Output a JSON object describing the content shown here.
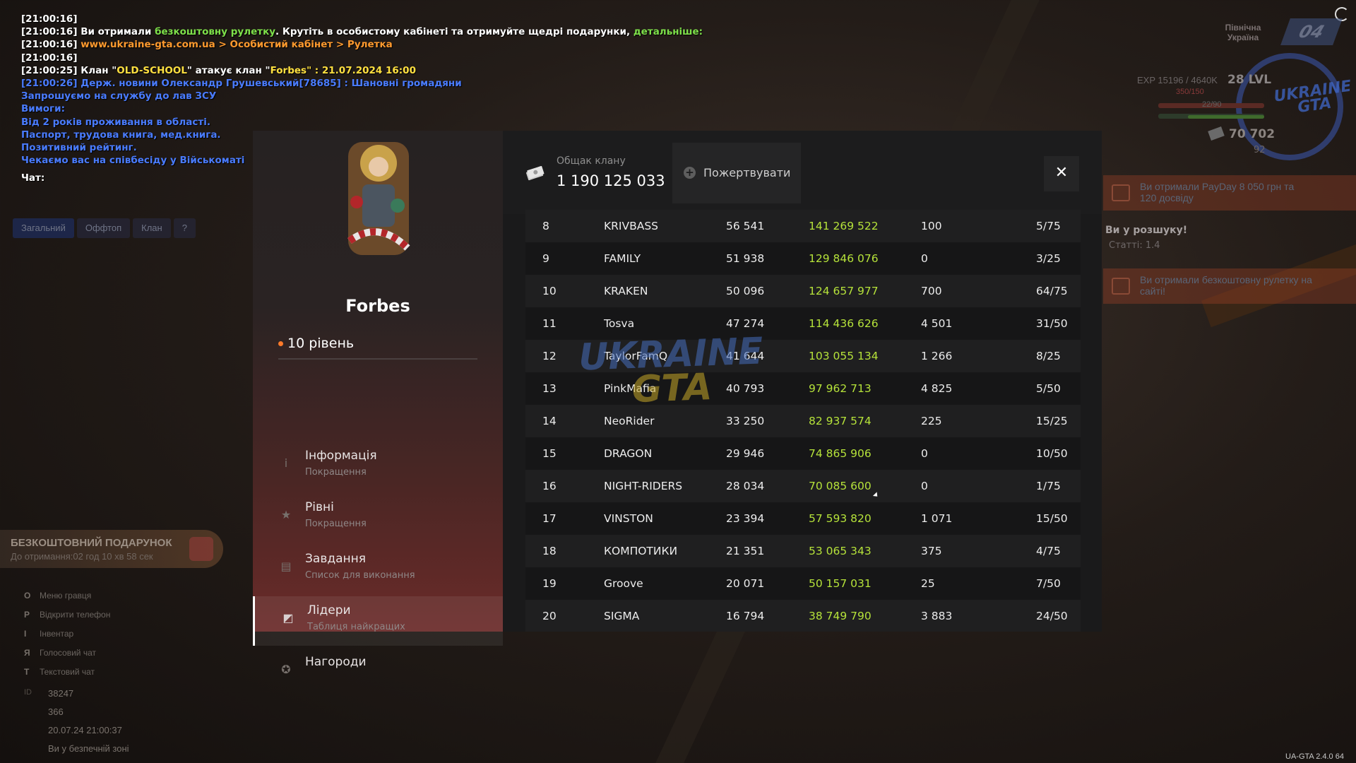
{
  "chat": {
    "lines": [
      {
        "ts": "[21:00:16]",
        "parts": []
      },
      {
        "ts": "[21:00:16]",
        "parts": [
          {
            "t": " Ви отримали ",
            "c": "white"
          },
          {
            "t": "безкоштовну рулетку",
            "c": "green"
          },
          {
            "t": ". Крутіть в особистому кабінеті та отримуйте щедрі подарунки, ",
            "c": "white"
          },
          {
            "t": "детальніше:",
            "c": "green"
          }
        ]
      },
      {
        "ts": "[21:00:16]",
        "parts": [
          {
            "t": " www.ukraine-gta.com.ua > Особистий кабінет > Рулетка",
            "c": "orange"
          }
        ]
      },
      {
        "ts": "[21:00:16]",
        "parts": []
      },
      {
        "ts": "[21:00:25]",
        "parts": [
          {
            "t": " Клан \"",
            "c": "white"
          },
          {
            "t": "OLD-SCHOOL",
            "c": "yellow"
          },
          {
            "t": "\" атакує клан \"",
            "c": "white"
          },
          {
            "t": "Forbes",
            "c": "yellow"
          },
          {
            "t": "\" : 21.07.2024 16:00",
            "c": "yellow"
          }
        ]
      },
      {
        "ts": "",
        "parts": [
          {
            "t": "[21:00:26] Держ. новини Олександр Грушевський[78685] : Шановні громадяни",
            "c": "blue"
          }
        ]
      },
      {
        "ts": "",
        "parts": [
          {
            "t": "Запрошуємо на службу до лав ЗСУ",
            "c": "blue"
          }
        ]
      },
      {
        "ts": "",
        "parts": [
          {
            "t": "Вимоги:",
            "c": "blue"
          }
        ]
      },
      {
        "ts": "",
        "parts": [
          {
            "t": "Від 2 років проживання в області.",
            "c": "blue"
          }
        ]
      },
      {
        "ts": "",
        "parts": [
          {
            "t": "Паспорт, трудова книга, мед.книга.",
            "c": "blue"
          }
        ]
      },
      {
        "ts": "",
        "parts": [
          {
            "t": "Позитивний рейтинг.",
            "c": "blue"
          }
        ]
      },
      {
        "ts": "",
        "parts": [
          {
            "t": "Чекаємо вас на співбесіду у Військоматі",
            "c": "blue"
          }
        ]
      }
    ],
    "label": "Чат:",
    "tabs": [
      "Загальний",
      "Оффтоп",
      "Клан",
      "?"
    ]
  },
  "hud_left": {
    "gift_title": "БЕЗКОШТОВНИЙ ПОДАРУНОК",
    "gift_sub": "До отримання:02 год 10 хв 58 сек",
    "keys": [
      {
        "key": "O",
        "label": "Меню гравця"
      },
      {
        "key": "P",
        "label": "Відкрити телефон"
      },
      {
        "key": "I",
        "label": "Інвентар"
      },
      {
        "key": "Я",
        "label": "Голосовий чат"
      },
      {
        "key": "T",
        "label": "Текстовий чат"
      }
    ],
    "stats": [
      {
        "label": "ID",
        "value": "38247"
      },
      {
        "label": "",
        "value": "366"
      },
      {
        "label": "",
        "value": "20.07.24 21:00:37"
      },
      {
        "label": "",
        "value": "Ви у безпечній зоні"
      }
    ]
  },
  "hud_right": {
    "region": "Північна Україна",
    "region_code": "04",
    "exp": "EXP 15196 / 4640K",
    "level": "28 LVL",
    "hp": "350/150",
    "armor": "22/90",
    "money": "70 702",
    "coins": "92",
    "notif1": "Ви отримали PayDay 8 050 грн та 120 досвіду",
    "notif2": "Ви отримали безкоштовну рулетку на сайті!",
    "wanted": "Ви у розшуку!",
    "wanted_sub": "Статті: 1.4",
    "version": "UA-GTA 2.4.0   64",
    "logo": "UKRAINE GTA"
  },
  "clan": {
    "name": "Forbes",
    "level": "10 рівень",
    "menu": [
      {
        "title": "Інформація",
        "sub": "Покращення",
        "icon": "info-icon"
      },
      {
        "title": "Рівні",
        "sub": "Покращення",
        "icon": "star-icon"
      },
      {
        "title": "Завдання",
        "sub": "Список для виконання",
        "icon": "chat-icon"
      },
      {
        "title": "Лідери",
        "sub": "Таблиця найкращих",
        "icon": "chart-icon"
      },
      {
        "title": "Нагороди",
        "sub": "",
        "icon": "medal-icon"
      }
    ],
    "active_index": 3
  },
  "bank": {
    "label": "Общак клану",
    "value": "1 190 125 033",
    "donate_label": "Пожертвувати",
    "close": "✕"
  },
  "leaders": [
    [
      "8",
      "KRIVBASS",
      "56 541",
      "141 269 522",
      "100",
      "5/75"
    ],
    [
      "9",
      "FAMILY",
      "51 938",
      "129 846 076",
      "0",
      "3/25"
    ],
    [
      "10",
      "KRAKEN",
      "50 096",
      "124 657 977",
      "700",
      "64/75"
    ],
    [
      "11",
      "Tosva",
      "47 274",
      "114 436 626",
      "4 501",
      "31/50"
    ],
    [
      "12",
      "TaylorFamQ",
      "41 644",
      "103 055 134",
      "1 266",
      "8/25"
    ],
    [
      "13",
      "PinkMafia",
      "40 793",
      "97 962 713",
      "4 825",
      "5/50"
    ],
    [
      "14",
      "NeoRider",
      "33 250",
      "82 937 574",
      "225",
      "15/25"
    ],
    [
      "15",
      "DRAGON",
      "29 946",
      "74 865 906",
      "0",
      "10/50"
    ],
    [
      "16",
      "NIGHT-RIDERS",
      "28 034",
      "70 085 600",
      "0",
      "1/75"
    ],
    [
      "17",
      "VINSTON",
      "23 394",
      "57 593 820",
      "1 071",
      "15/50"
    ],
    [
      "18",
      "КОМПОТИКИ",
      "21 351",
      "53 065 343",
      "375",
      "4/75"
    ],
    [
      "19",
      "Groove",
      "20 071",
      "50 157 031",
      "25",
      "7/50"
    ],
    [
      "20",
      "SIGMA",
      "16 794",
      "38 749 790",
      "3 883",
      "24/50"
    ]
  ],
  "watermark": {
    "line1": "UKRAINE",
    "line2": "GTA"
  },
  "colors": {
    "money_green": "#b6e33a",
    "accent_orange": "#ff7a2a",
    "chat_blue": "#4a7cff"
  }
}
